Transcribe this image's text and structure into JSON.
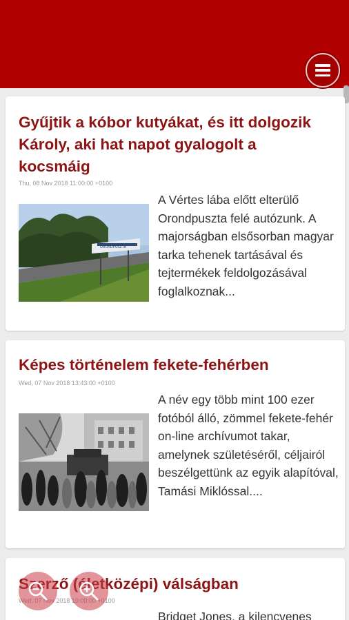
{
  "header": {
    "menu_icon": "hamburger-icon",
    "brand_color": "#b00000"
  },
  "articles": [
    {
      "title": "Gyűjtik a kóbor kutyákat, és itt dolgozik Károly, aki hat napot gyalogolt a kocsmáig",
      "date": "Thu, 08 Nov 2018 11:00:00 +0100",
      "sign_text": "ORONDPUSZTA",
      "excerpt": "A Vértes lába előtt elterülő Orondpuszta felé autózunk. A majorságban elsősorban magyar tarka tehenek tartásával és tejtermékek feldolgozásával foglalkoznak..."
    },
    {
      "title": "Képes történelem fekete-fehérben",
      "date": "Wed, 07 Nov 2018 13:43:00 +0100",
      "excerpt": "A név egy több mint 100 ezer fotóból álló, zömmel fekete-fehér on-line archívumot takar, amelynek születéséről, céljairól beszélgettünk az egyik alapítóval, Tamási Miklóssal...."
    },
    {
      "title": "Szerző (életközépi) válságban",
      "date": "Wed, 07 Nov 2018 10:00:00 +0100",
      "excerpt": "Bridget Jones, a kilencvenes"
    }
  ],
  "zoom": {
    "zoom_out_icon": "zoom-out-icon",
    "zoom_in_icon": "zoom-in-icon"
  }
}
